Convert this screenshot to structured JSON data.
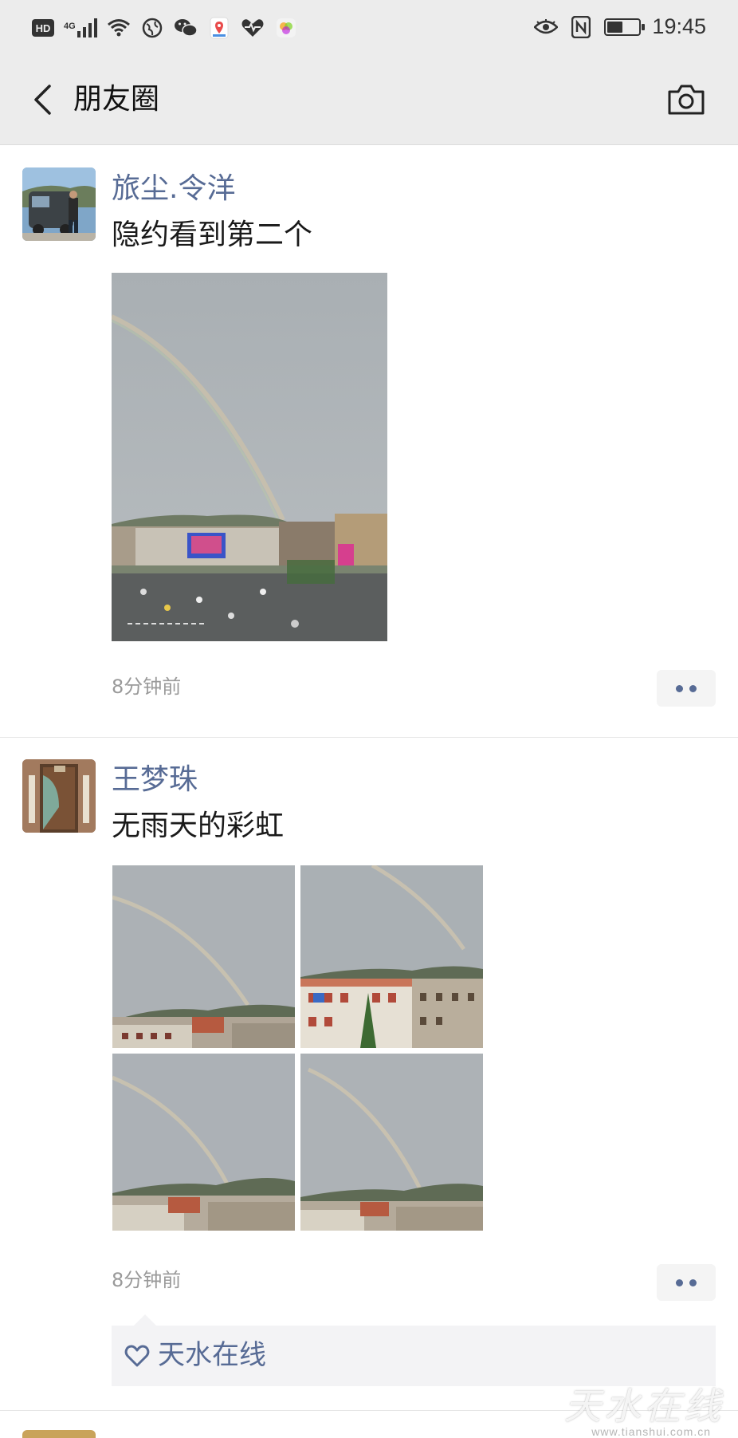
{
  "status_bar": {
    "hd_label": "HD",
    "network_label": "4G",
    "time": "19:45",
    "battery_level": 0.5,
    "icons": [
      "hd-icon",
      "signal-icon",
      "wifi-icon",
      "globe-icon",
      "wechat-icon",
      "maps-icon",
      "health-icon",
      "app-icon",
      "eye-icon",
      "nfc-icon",
      "battery-icon"
    ]
  },
  "nav": {
    "title": "朋友圈",
    "back_icon": "chevron-left-icon",
    "camera_icon": "camera-icon"
  },
  "posts": [
    {
      "username": "旅尘.令洋",
      "text": "隐约看到第二个",
      "timestamp": "8分钟前",
      "photo_count": 1
    },
    {
      "username": "王梦珠",
      "text": "无雨天的彩虹",
      "timestamp": "8分钟前",
      "photo_count": 4,
      "likes": [
        "天水在线"
      ]
    }
  ],
  "colors": {
    "link": "#576b95",
    "bar_bg": "#ececec",
    "muted": "#9a9a9a"
  },
  "watermark": {
    "text": "天水在线",
    "url": "www.tianshui.com.cn"
  }
}
